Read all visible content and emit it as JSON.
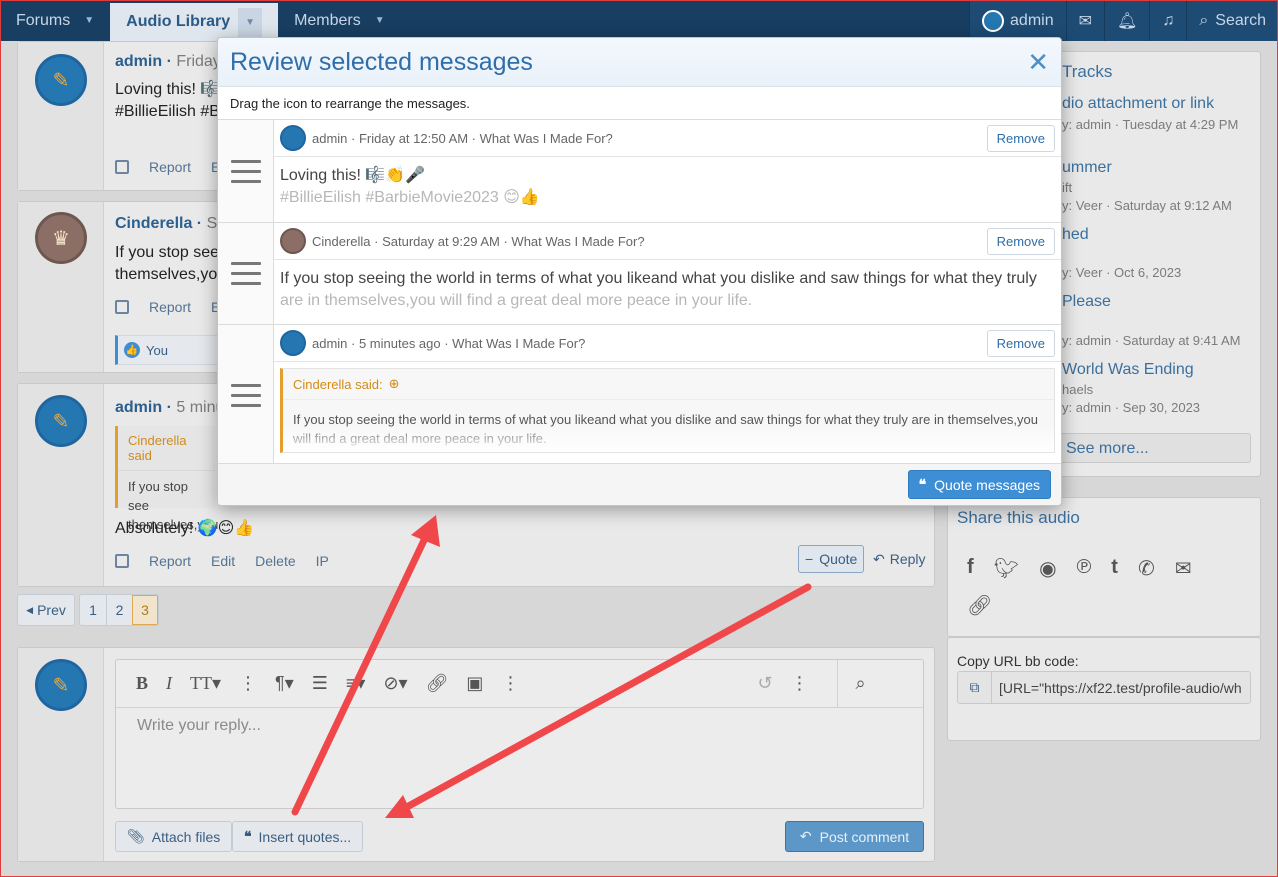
{
  "nav": {
    "tabs": [
      "Forums",
      "Audio Library",
      "Members"
    ],
    "user": "admin",
    "search_label": "Search"
  },
  "posts": [
    {
      "author": "admin",
      "time": "Friday",
      "line1": "Loving this! 🎼",
      "line2": "#BillieEilish #Ba",
      "actions": [
        "Report",
        "E"
      ]
    },
    {
      "author": "Cinderella",
      "time": "Sa",
      "line1": "If you stop see",
      "line2": "themselves,you",
      "actions": [
        "Report",
        "E"
      ],
      "reaction": "You"
    },
    {
      "author": "admin",
      "time": "5 minu",
      "quote_author": "Cinderella said",
      "quote_line1": "If you stop see",
      "quote_line2": "themselves,you",
      "text": "Absolutely! 🌍😊👍",
      "actions": [
        "Report",
        "Edit",
        "Delete",
        "IP"
      ],
      "quote_btn": "Quote",
      "reply_btn": "Reply"
    }
  ],
  "pagination": {
    "prev": "Prev",
    "pages": [
      "1",
      "2",
      "3"
    ]
  },
  "editor": {
    "placeholder": "Write your reply...",
    "attach_label": "Attach files",
    "insert_quotes_label": "Insert quotes...",
    "post_label": "Post comment"
  },
  "sidebar": {
    "tracks_title": "Tracks",
    "items": [
      {
        "title": "dio attachment or link",
        "meta": "y: admin · Tuesday at 4:29 PM"
      },
      {
        "title": "ummer",
        "sub": "ift",
        "meta": "y: Veer · Saturday at 9:12 AM"
      },
      {
        "title": "hed",
        "meta": "y: Veer · Oct 6, 2023"
      },
      {
        "title": "Please",
        "meta": "y: admin · Saturday at 9:41 AM"
      },
      {
        "title": "World Was Ending",
        "sub": "haels",
        "meta": "y: admin · Sep 30, 2023"
      }
    ],
    "see_more": "See more...",
    "share_title": "Share this audio",
    "copy_label": "Copy URL bb code:",
    "copy_value": "[URL=\"https://xf22.test/profile-audio/wh"
  },
  "modal": {
    "title": "Review selected messages",
    "hint": "Drag the icon to rearrange the messages.",
    "remove_label": "Remove",
    "quote_messages_label": "Quote messages",
    "messages": [
      {
        "meta": "admin · Friday at 12:50 AM · What Was I Made For?",
        "line1": "Loving this! 🎼👏🎤",
        "line2": "#BillieEilish #BarbieMovie2023 😊👍"
      },
      {
        "meta": "Cinderella · Saturday at 9:29 AM · What Was I Made For?",
        "line1": "If you stop seeing the world in terms of what you likeand what you dislike and saw things for what they truly",
        "line2": "are in themselves,you will find a great deal more peace in your life."
      },
      {
        "meta": "admin · 5 minutes ago · What Was I Made For?",
        "quote_author": "Cinderella said:",
        "quote_text": "If you stop seeing the world in terms of what you likeand what you dislike and saw things for what they truly are in themselves,you will find a great deal more peace in your life."
      }
    ]
  },
  "colors": {
    "annotation_arrow": "#f0474a",
    "accent": "#2f6ea8",
    "quote_border": "#e59d2b"
  }
}
